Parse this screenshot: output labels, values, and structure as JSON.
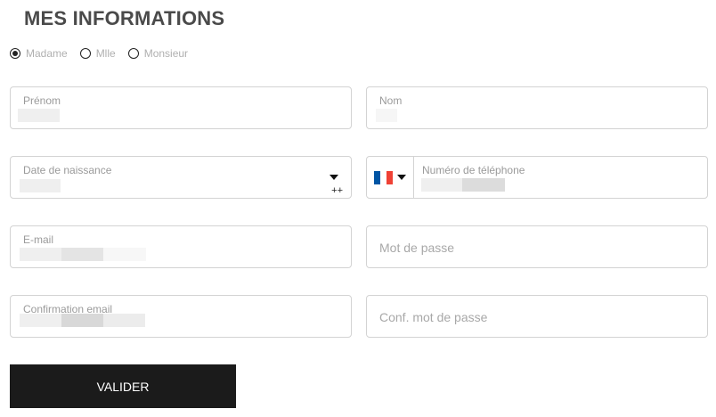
{
  "page": {
    "title": "MES INFORMATIONS"
  },
  "civility": {
    "options": [
      {
        "label": "Madame",
        "checked": true
      },
      {
        "label": "Mlle",
        "checked": false
      },
      {
        "label": "Monsieur",
        "checked": false
      }
    ]
  },
  "fields": {
    "firstname": {
      "label": "Prénom"
    },
    "lastname": {
      "label": "Nom"
    },
    "birthdate": {
      "label": "Date de naissance",
      "suffix": "++"
    },
    "phone": {
      "label": "Numéro de téléphone",
      "flag": {
        "colors": [
          "#0055a4",
          "#ffffff",
          "#ef4135"
        ]
      }
    },
    "email": {
      "label": "E-mail"
    },
    "password": {
      "placeholder": "Mot de passe"
    },
    "email_confirm": {
      "label": "Confirmation email"
    },
    "password_confirm": {
      "placeholder": "Conf. mot de passe"
    }
  },
  "submit": {
    "label": "VALIDER"
  }
}
